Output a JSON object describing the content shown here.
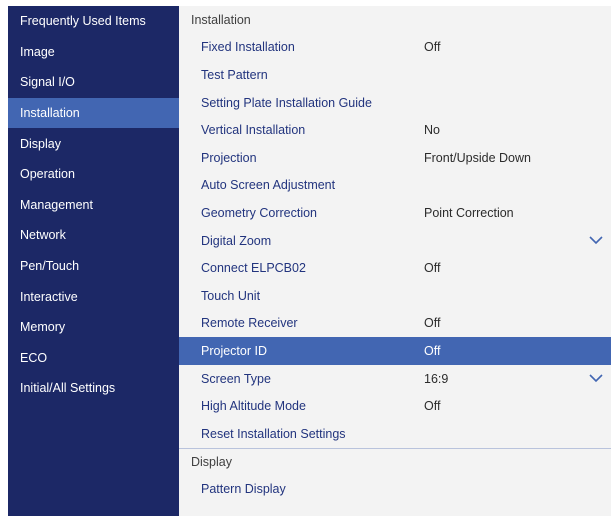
{
  "sidebar": {
    "items": [
      {
        "label": "Frequently Used Items",
        "active": false
      },
      {
        "label": "Image",
        "active": false
      },
      {
        "label": "Signal I/O",
        "active": false
      },
      {
        "label": "Installation",
        "active": true
      },
      {
        "label": "Display",
        "active": false
      },
      {
        "label": "Operation",
        "active": false
      },
      {
        "label": "Management",
        "active": false
      },
      {
        "label": "Network",
        "active": false
      },
      {
        "label": "Pen/Touch",
        "active": false
      },
      {
        "label": "Interactive",
        "active": false
      },
      {
        "label": "Memory",
        "active": false
      },
      {
        "label": "ECO",
        "active": false
      },
      {
        "label": "Initial/All Settings",
        "active": false
      }
    ]
  },
  "main": {
    "section_title": "Installation",
    "rows": [
      {
        "label": "Fixed Installation",
        "value": "Off"
      },
      {
        "label": "Test Pattern",
        "value": ""
      },
      {
        "label": "Setting Plate Installation Guide",
        "value": ""
      },
      {
        "label": "Vertical Installation",
        "value": "No"
      },
      {
        "label": "Projection",
        "value": "Front/Upside Down"
      },
      {
        "label": "Auto Screen Adjustment",
        "value": ""
      },
      {
        "label": "Geometry Correction",
        "value": "Point Correction"
      },
      {
        "label": "Digital Zoom",
        "value": "",
        "dropdown": true
      },
      {
        "label": "Connect ELPCB02",
        "value": "Off"
      },
      {
        "label": "Touch Unit",
        "value": ""
      },
      {
        "label": "Remote Receiver",
        "value": "Off"
      },
      {
        "label": "Projector ID",
        "value": "Off",
        "selected": true
      },
      {
        "label": "Screen Type",
        "value": "16:9",
        "dropdown": true
      },
      {
        "label": "High Altitude Mode",
        "value": "Off"
      },
      {
        "label": "Reset Installation Settings",
        "value": ""
      }
    ],
    "second_section_title": "Display",
    "second_rows": [
      {
        "label": "Pattern Display",
        "value": ""
      }
    ]
  },
  "colors": {
    "sidebar_bg": "#1c2866",
    "highlight": "#4266b2",
    "label_text": "#22347e",
    "panel_bg": "#f3f3f3"
  },
  "icons": {
    "dropdown": "chevron-down-icon"
  }
}
